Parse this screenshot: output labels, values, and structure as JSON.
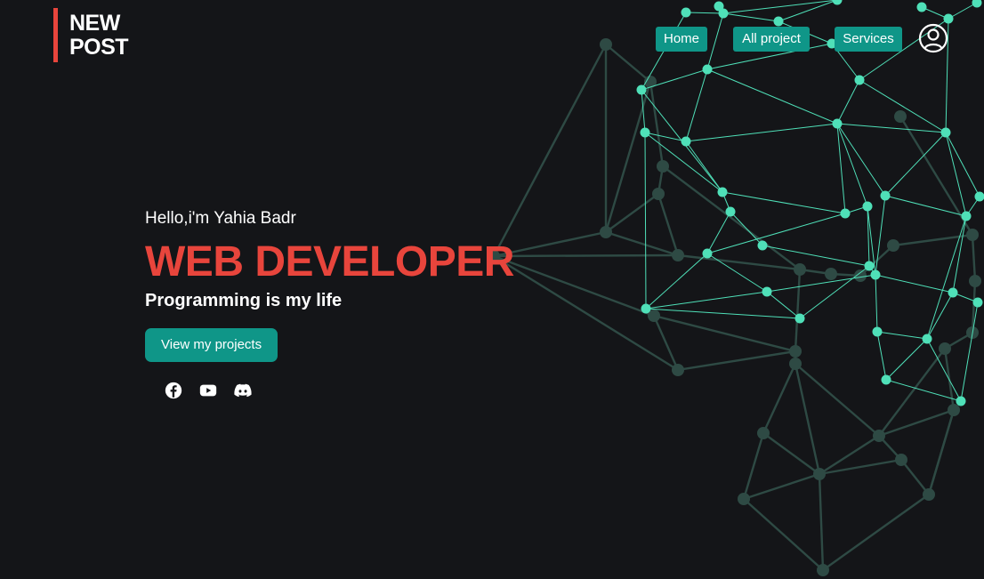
{
  "brand": {
    "line1": "NEW",
    "line2": "POST",
    "accent_color": "#e8453c"
  },
  "nav": {
    "items": [
      {
        "label": "Home"
      },
      {
        "label": "All project"
      },
      {
        "label": "Services"
      }
    ],
    "button_color": "#0f9688",
    "user_icon": "user-circle-icon"
  },
  "hero": {
    "greeting": "Hello,i'm Yahia Badr",
    "role": "WEB DEVELOPER",
    "tagline": "Programming is my life",
    "cta_label": "View my projects",
    "role_color": "#e8453c"
  },
  "socials": [
    {
      "icon": "facebook-icon"
    },
    {
      "icon": "youtube-icon"
    },
    {
      "icon": "discord-icon"
    }
  ],
  "background": {
    "color": "#141518",
    "network_bright_color": "#4fe0b8",
    "network_dim_color": "#2e4a44"
  }
}
